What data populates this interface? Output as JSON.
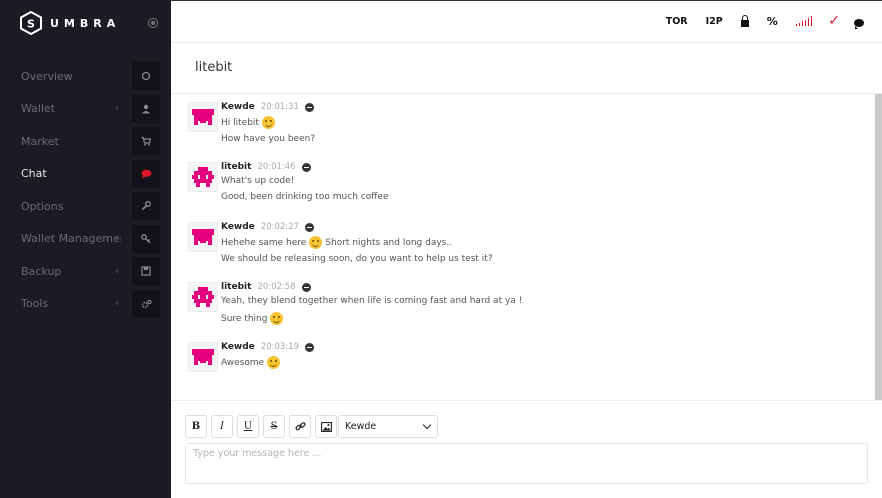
{
  "app": {
    "name": "UMBRA"
  },
  "sidebar": {
    "items": [
      {
        "label": "Overview",
        "icon": "circle-icon",
        "chevron": false,
        "active": false
      },
      {
        "label": "Wallet",
        "icon": "user-icon",
        "chevron": true,
        "active": false
      },
      {
        "label": "Market",
        "icon": "cart-icon",
        "chevron": false,
        "active": false
      },
      {
        "label": "Chat",
        "icon": "chat-icon",
        "chevron": false,
        "active": true
      },
      {
        "label": "Options",
        "icon": "wrench-icon",
        "chevron": false,
        "active": false
      },
      {
        "label": "Wallet Management",
        "icon": "key-icon",
        "chevron": true,
        "active": false
      },
      {
        "label": "Backup",
        "icon": "floppy-icon",
        "chevron": true,
        "active": false
      },
      {
        "label": "Tools",
        "icon": "gears-icon",
        "chevron": true,
        "active": false
      }
    ]
  },
  "topbar": {
    "tor": "TOR",
    "i2p": "I2P",
    "percent": "%",
    "accent": "#e0162b"
  },
  "chat": {
    "title": "litebit",
    "messages": [
      {
        "user": "Kewde",
        "time": "20:01:31",
        "lines": [
          {
            "text": "Hi litebit",
            "emoji": true,
            "after": ""
          },
          {
            "text": "How have you been?",
            "emoji": false,
            "after": ""
          }
        ]
      },
      {
        "user": "litebit",
        "time": "20:01:46",
        "lines": [
          {
            "text": "What's up code!",
            "emoji": false,
            "after": ""
          },
          {
            "text": "Good, been drinking too much coffee",
            "emoji": false,
            "after": ""
          }
        ]
      },
      {
        "user": "Kewde",
        "time": "20:02:27",
        "lines": [
          {
            "text": "Hehehe same here",
            "emoji": true,
            "after": "Short nights and long days.."
          },
          {
            "text": "We should be releasing soon, do you want to help us test it?",
            "emoji": false,
            "after": ""
          }
        ]
      },
      {
        "user": "litebit",
        "time": "20:02:58",
        "lines": [
          {
            "text": "Yeah, they blend together when life is coming fast and hard at ya !",
            "emoji": false,
            "after": ""
          },
          {
            "text": "Sure thing",
            "emoji": true,
            "after": ""
          }
        ]
      },
      {
        "user": "Kewde",
        "time": "20:03:19",
        "lines": [
          {
            "text": "Awesome",
            "emoji": true,
            "after": ""
          }
        ]
      }
    ]
  },
  "composer": {
    "buttons": [
      "B",
      "I",
      "U",
      "S"
    ],
    "selected_user": "Kewde",
    "placeholder": "Type your message here ..."
  }
}
